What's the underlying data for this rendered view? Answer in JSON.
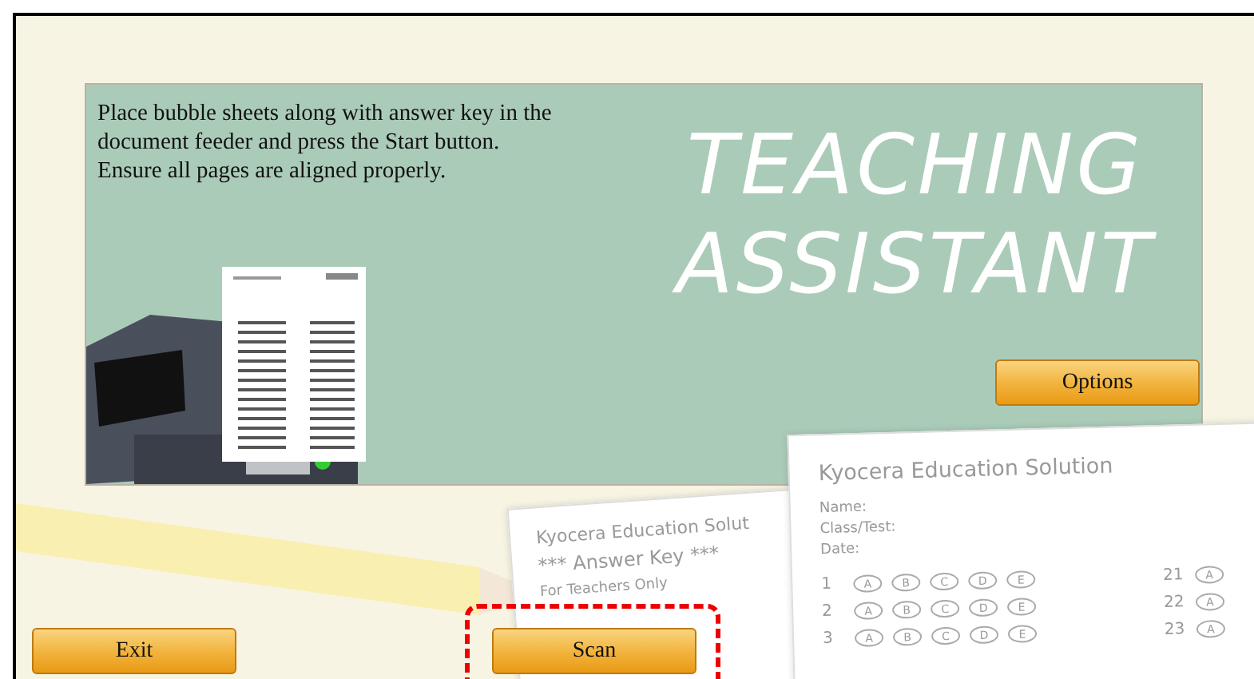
{
  "board": {
    "instructions": [
      "Place bubble sheets along with answer key in the document feeder and press the Start button.",
      "Ensure all pages are aligned properly."
    ],
    "title_lines": [
      "TEACHING",
      "ASSISTANT"
    ],
    "options_button": {
      "label": "Options"
    }
  },
  "answer_key_sheet": {
    "heading": "Kyocera Education Solut",
    "subheading": "*** Answer Key ***",
    "note": "For Teachers Only"
  },
  "bubble_sheet": {
    "heading": "Kyocera Education Solution",
    "fields": [
      "Name:",
      "Class/Test:",
      "Date:"
    ],
    "left_rows": [
      {
        "number": "1",
        "options": [
          "A",
          "B",
          "C",
          "D",
          "E"
        ]
      },
      {
        "number": "2",
        "options": [
          "A",
          "B",
          "C",
          "D",
          "E"
        ]
      },
      {
        "number": "3",
        "options": [
          "A",
          "B",
          "C",
          "D",
          "E"
        ]
      }
    ],
    "right_rows": [
      {
        "number": "21",
        "options": [
          "A"
        ]
      },
      {
        "number": "22",
        "options": [
          "A"
        ]
      },
      {
        "number": "23",
        "options": [
          "A"
        ]
      }
    ]
  },
  "buttons": [
    {
      "label": "Exit",
      "highlighted": false
    },
    {
      "label": "Scan",
      "highlighted": true
    }
  ]
}
